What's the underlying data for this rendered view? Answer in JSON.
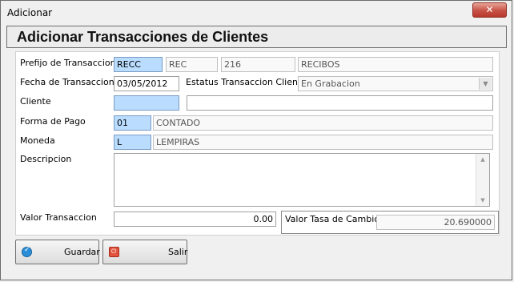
{
  "window": {
    "title": "Adicionar",
    "close_glyph": "✕"
  },
  "header": {
    "title": "Adicionar Transacciones de Clientes"
  },
  "form": {
    "prefijo": {
      "label": "Prefijo de Transaccion",
      "code": "RECC",
      "sub_code": "REC",
      "number": "216",
      "description": "RECIBOS"
    },
    "fecha": {
      "label": "Fecha de Transaccion",
      "value": "03/05/2012"
    },
    "estatus": {
      "label": "Estatus Transaccion Cliente",
      "value": "En Grabacion"
    },
    "cliente": {
      "label": "Cliente",
      "code": "",
      "name": ""
    },
    "forma_pago": {
      "label": "Forma de Pago",
      "code": "01",
      "description": "CONTADO"
    },
    "moneda": {
      "label": "Moneda",
      "code": "L",
      "description": "LEMPIRAS"
    },
    "descripcion": {
      "label": "Descripcion",
      "value": ""
    },
    "valor_transaccion": {
      "label": "Valor Transaccion",
      "value": "0.00"
    },
    "valor_tasa": {
      "label": "Valor Tasa de Cambio",
      "value": "20.690000"
    }
  },
  "buttons": {
    "guardar": "Guardar",
    "salir": "Salir"
  },
  "icons": {
    "save": "check-circle-icon",
    "exit": "power-icon",
    "dropdown": "chevron-down-icon"
  },
  "colors": {
    "lookup_field": "#b9dcff"
  }
}
